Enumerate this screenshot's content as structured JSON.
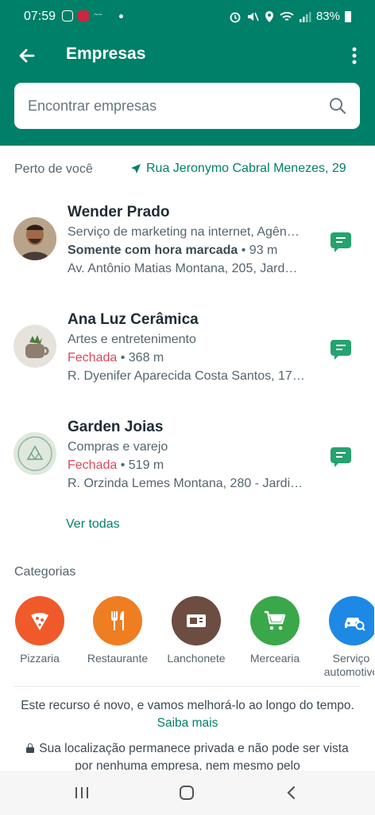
{
  "status": {
    "time": "07:59",
    "battery": "83%"
  },
  "appbar": {
    "title": "Empresas"
  },
  "search": {
    "placeholder": "Encontrar empresas"
  },
  "nearby": {
    "label": "Perto de você",
    "location": "Rua Jeronymo Cabral Menezes, 29"
  },
  "businesses": [
    {
      "name": "Wender Prado",
      "category": "Serviço de marketing na internet, Agên…",
      "status": "Somente com hora marcada",
      "distance": "93 m",
      "address": "Av. Antônio Matias Montana, 205, Jard…"
    },
    {
      "name": "Ana Luz Cerâmica",
      "category": "Artes e entretenimento",
      "status": "Fechada",
      "distance": "368 m",
      "address": "R. Dyenifer Aparecida Costa Santos, 17…"
    },
    {
      "name": "Garden Joias",
      "category": "Compras e varejo",
      "status": "Fechada",
      "distance": "519 m",
      "address": "R. Orzinda Lemes Montana, 280 - Jardi…"
    }
  ],
  "see_all": "Ver todas",
  "categories": {
    "title": "Categorias",
    "items": [
      {
        "label": "Pizzaria",
        "color": "#f05a2a",
        "icon": "pizza-icon"
      },
      {
        "label": "Restaurante",
        "color": "#ef7d22",
        "icon": "fork-knife-icon"
      },
      {
        "label": "Lanchonete",
        "color": "#6d4c41",
        "icon": "cafe-icon"
      },
      {
        "label": "Mercearia",
        "color": "#3aa74a",
        "icon": "cart-icon"
      },
      {
        "label": "Serviço automotivo",
        "color": "#1e88e5",
        "icon": "car-icon"
      }
    ]
  },
  "footer": {
    "note": "Este recurso é novo, e vamos melhorá-lo ao longo do tempo.",
    "learn_more": "Saiba mais",
    "privacy": "Sua localização permanece privada e não pode ser vista por nenhuma empresa, nem mesmo pelo"
  },
  "colors": {
    "primary": "#008069",
    "closed": "#e0475b",
    "message": "#25a36f"
  }
}
